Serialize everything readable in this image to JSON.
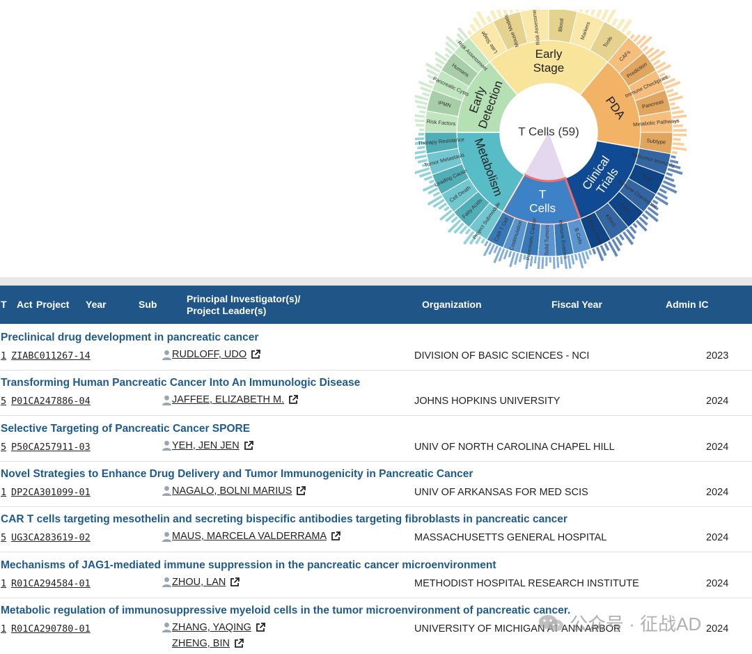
{
  "sunburst": {
    "center_label": "T Cells (59)",
    "inner_ring": [
      {
        "label": "Early Stage",
        "color": "#f8e49a"
      },
      {
        "label": "PDA",
        "color": "#f3b366"
      },
      {
        "label": "Clinical Trials",
        "color": "#104a93"
      },
      {
        "label": "T Cells",
        "color": "#3d82c6"
      },
      {
        "label": "Metabolism",
        "color": "#58bcc6"
      },
      {
        "label": "Early Detection",
        "color": "#b5e0b4"
      }
    ],
    "outer_labels": {
      "early_stage": [
        "Late Stage",
        "Mouse Models",
        "Risk Assessment",
        "Blood",
        "Markers",
        "Tools"
      ],
      "pda": [
        "CAFs",
        "Prediction",
        "Immune Checkpoint",
        "Pancreas",
        "Metabolic Pathways",
        "Subtype"
      ],
      "clinical_trials": [
        "Antitumor Immunity",
        "Tcell",
        "Immune Checkpoint",
        "CAFs",
        "KRAS",
        "Clinical Trials"
      ],
      "t_cells": [
        "B Cells",
        "Immune Evasion",
        "Solid Tumors",
        "Pancreatic Cancer",
        "Costimulation",
        "CAR T Cell"
      ],
      "metabolism": [
        "Project Submodule",
        "Fatty Acids",
        "Cell Death",
        "Leading Cause",
        "Tumor Metastasis",
        "Therapy Resistance"
      ],
      "early_detection": [
        "Risk Factors",
        "IPMN",
        "Pancreatic Cysts",
        "Humans",
        "Risk Assessment"
      ]
    }
  },
  "table": {
    "headers": {
      "type": "T",
      "activity": "Act",
      "project": "Project",
      "year": "Year",
      "sub": "Sub",
      "pi_line1": "Principal Investigator(s)/",
      "pi_line2": "Project Leader(s)",
      "organization": "Organization",
      "fiscal_year": "Fiscal Year",
      "admin_ic": "Admin IC"
    },
    "rows": [
      {
        "title": "Preclinical drug development in pancreatic cancer",
        "type": "1",
        "project_id": "ZIABC011267-14",
        "pis": [
          "RUDLOFF, UDO"
        ],
        "organization": "DIVISION OF BASIC SCIENCES - NCI",
        "fiscal_year": "2023"
      },
      {
        "title": "Transforming Human Pancreatic Cancer Into An Immunologic Disease",
        "type": "5",
        "project_id": "P01CA247886-04",
        "pis": [
          "JAFFEE, ELIZABETH M."
        ],
        "organization": "JOHNS HOPKINS UNIVERSITY",
        "fiscal_year": "2024"
      },
      {
        "title": "Selective Targeting of Pancreatic Cancer SPORE",
        "type": "5",
        "project_id": "P50CA257911-03",
        "pis": [
          "YEH, JEN JEN"
        ],
        "organization": "UNIV OF NORTH CAROLINA CHAPEL HILL",
        "fiscal_year": "2024"
      },
      {
        "title": "Novel Strategies to Enhance Drug Delivery and Tumor Immunogenicity in Pancreatic Cancer",
        "type": "1",
        "project_id": "DP2CA301099-01",
        "pis": [
          "NAGALO, BOLNI MARIUS"
        ],
        "organization": "UNIV OF ARKANSAS FOR MED SCIS",
        "fiscal_year": "2024"
      },
      {
        "title": "CAR T cells targeting mesothelin and secreting bispecific antibodies targeting fibroblasts in pancreatic cancer",
        "type": "5",
        "project_id": "UG3CA283619-02",
        "pis": [
          "MAUS, MARCELA VALDERRAMA"
        ],
        "organization": "MASSACHUSETTS GENERAL HOSPITAL",
        "fiscal_year": "2024"
      },
      {
        "title": "Mechanisms of JAG1-mediated immune suppression in the pancreatic cancer microenvironment",
        "type": "1",
        "project_id": "R01CA294584-01",
        "pis": [
          "ZHOU, LAN"
        ],
        "organization": "METHODIST HOSPITAL RESEARCH INSTITUTE",
        "fiscal_year": "2024"
      },
      {
        "title": "Metabolic regulation of immunosuppressive myeloid cells in the tumor microenvironment of pancreatic cancer.",
        "type": "1",
        "project_id": "R01CA290780-01",
        "pis": [
          "ZHANG, YAQING",
          "ZHENG, BIN"
        ],
        "organization": "UNIVERSITY OF MICHIGAN AT ANN ARBOR",
        "fiscal_year": "2024"
      }
    ]
  },
  "watermark": {
    "text": "公众号 · 征战AD"
  }
}
